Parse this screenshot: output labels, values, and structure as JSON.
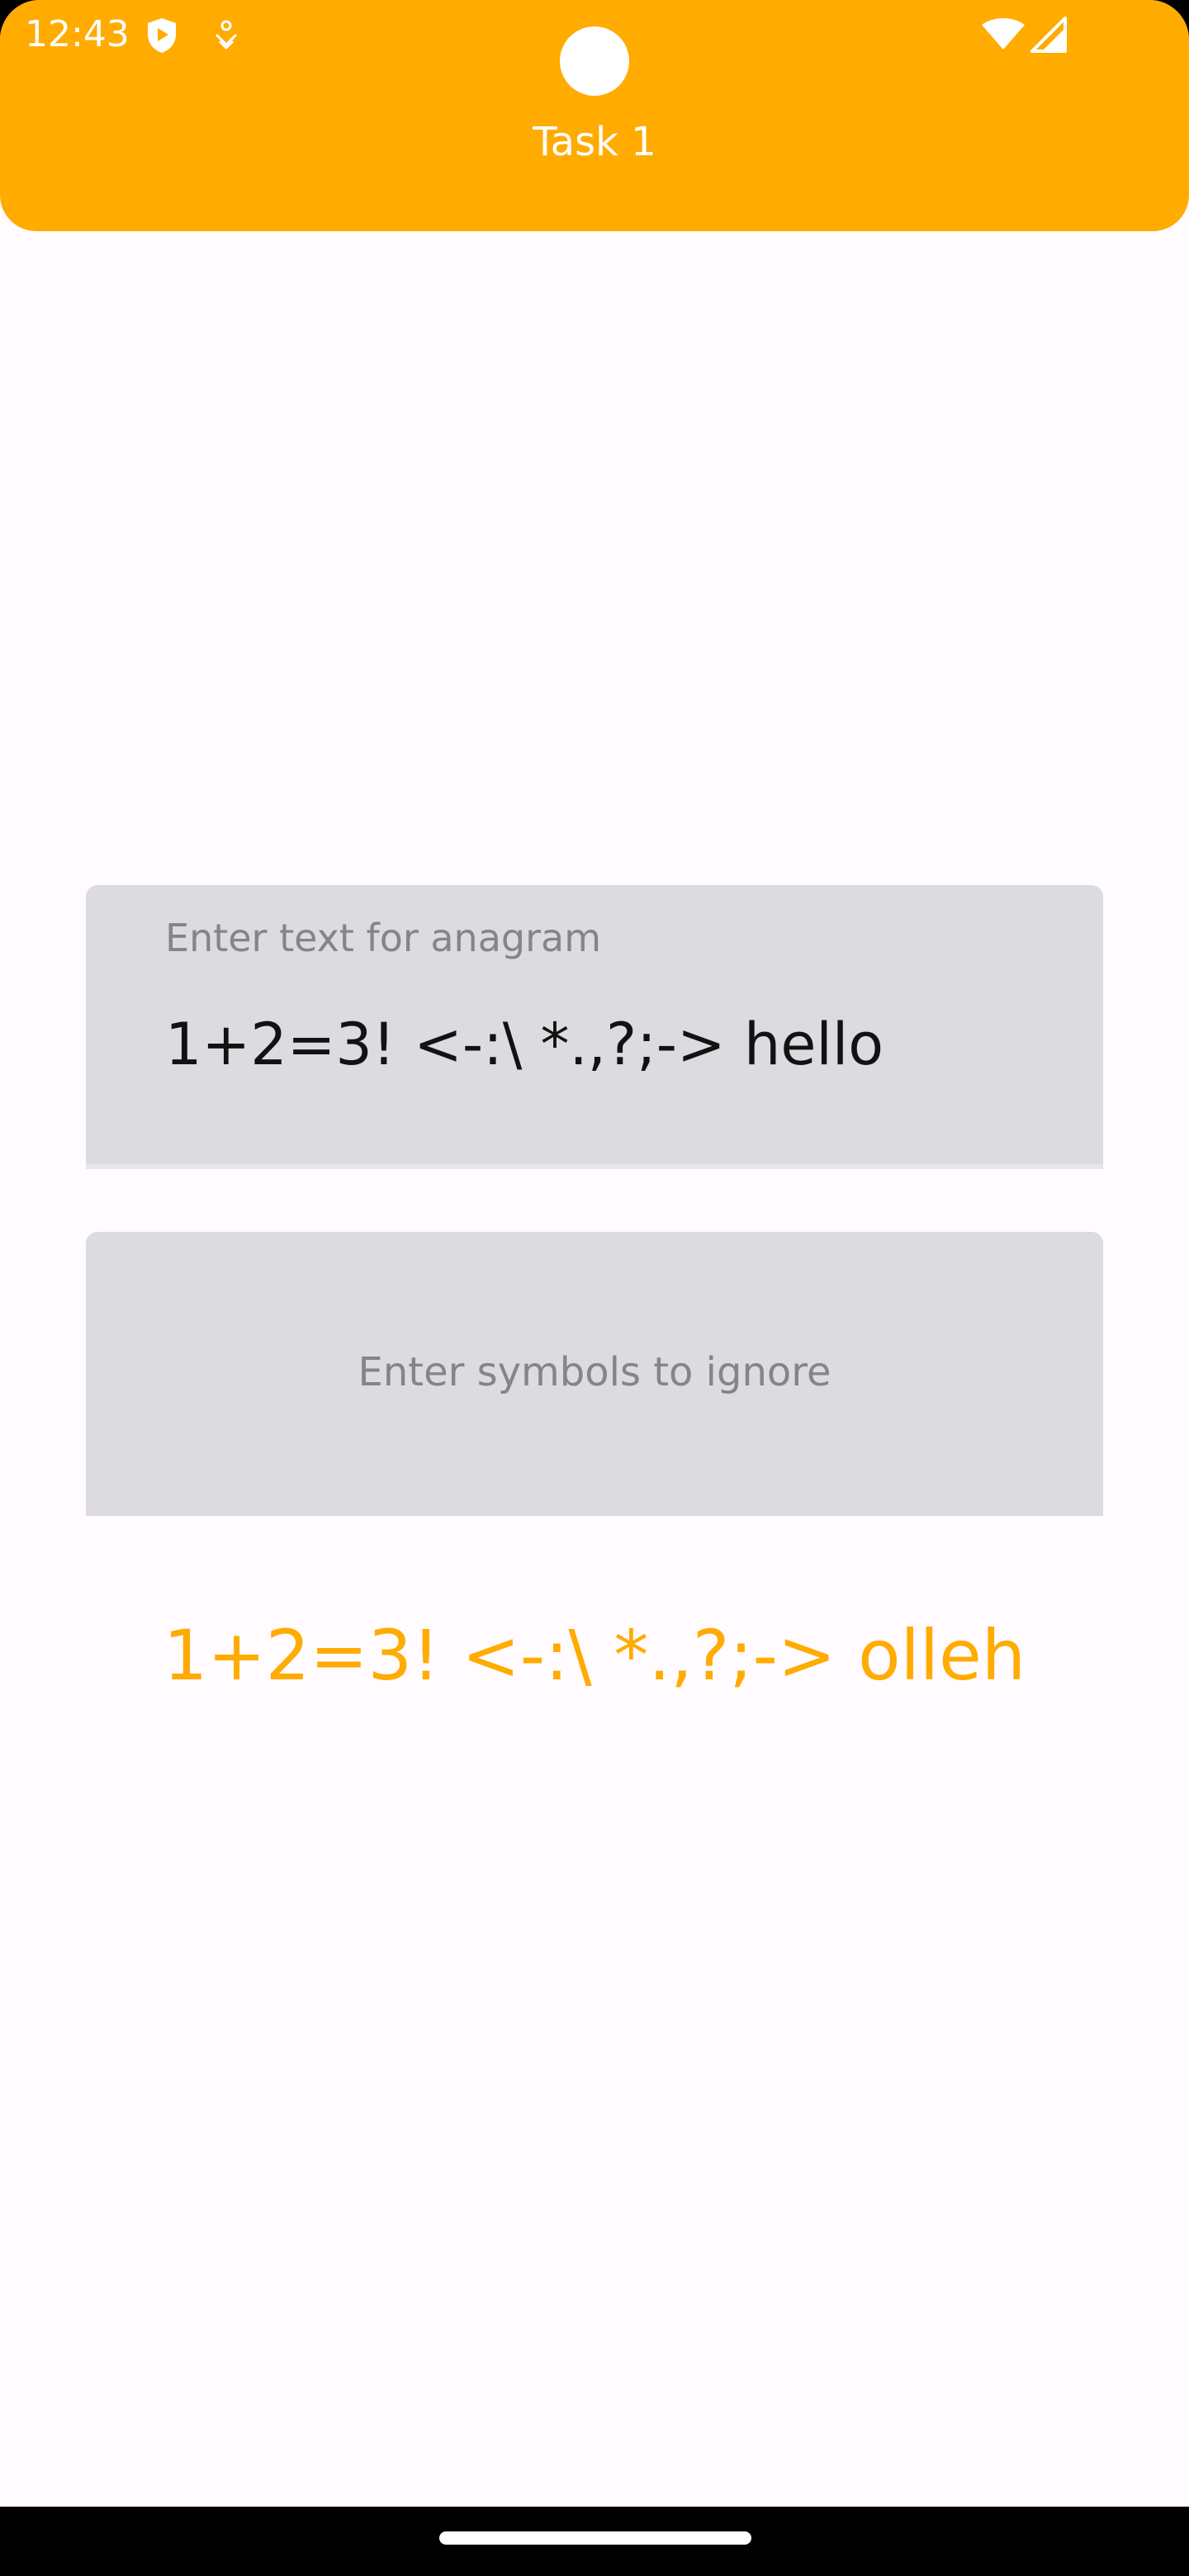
{
  "status_bar": {
    "time": "12:43",
    "icons": [
      "shield-play-icon",
      "app-notification-icon",
      "wifi-icon",
      "cellular-signal-icon"
    ]
  },
  "app_bar": {
    "title": "Task 1",
    "color": "#ffab00"
  },
  "anagram_field": {
    "label": "Enter text for anagram",
    "value": "1+2=3! <-:\\ *.,?;-> hello"
  },
  "ignore_field": {
    "placeholder": "Enter symbols to ignore",
    "value": ""
  },
  "result": {
    "text": "1+2=3! <-:\\ *.,?;-> olleh",
    "color": "#ffab00"
  }
}
